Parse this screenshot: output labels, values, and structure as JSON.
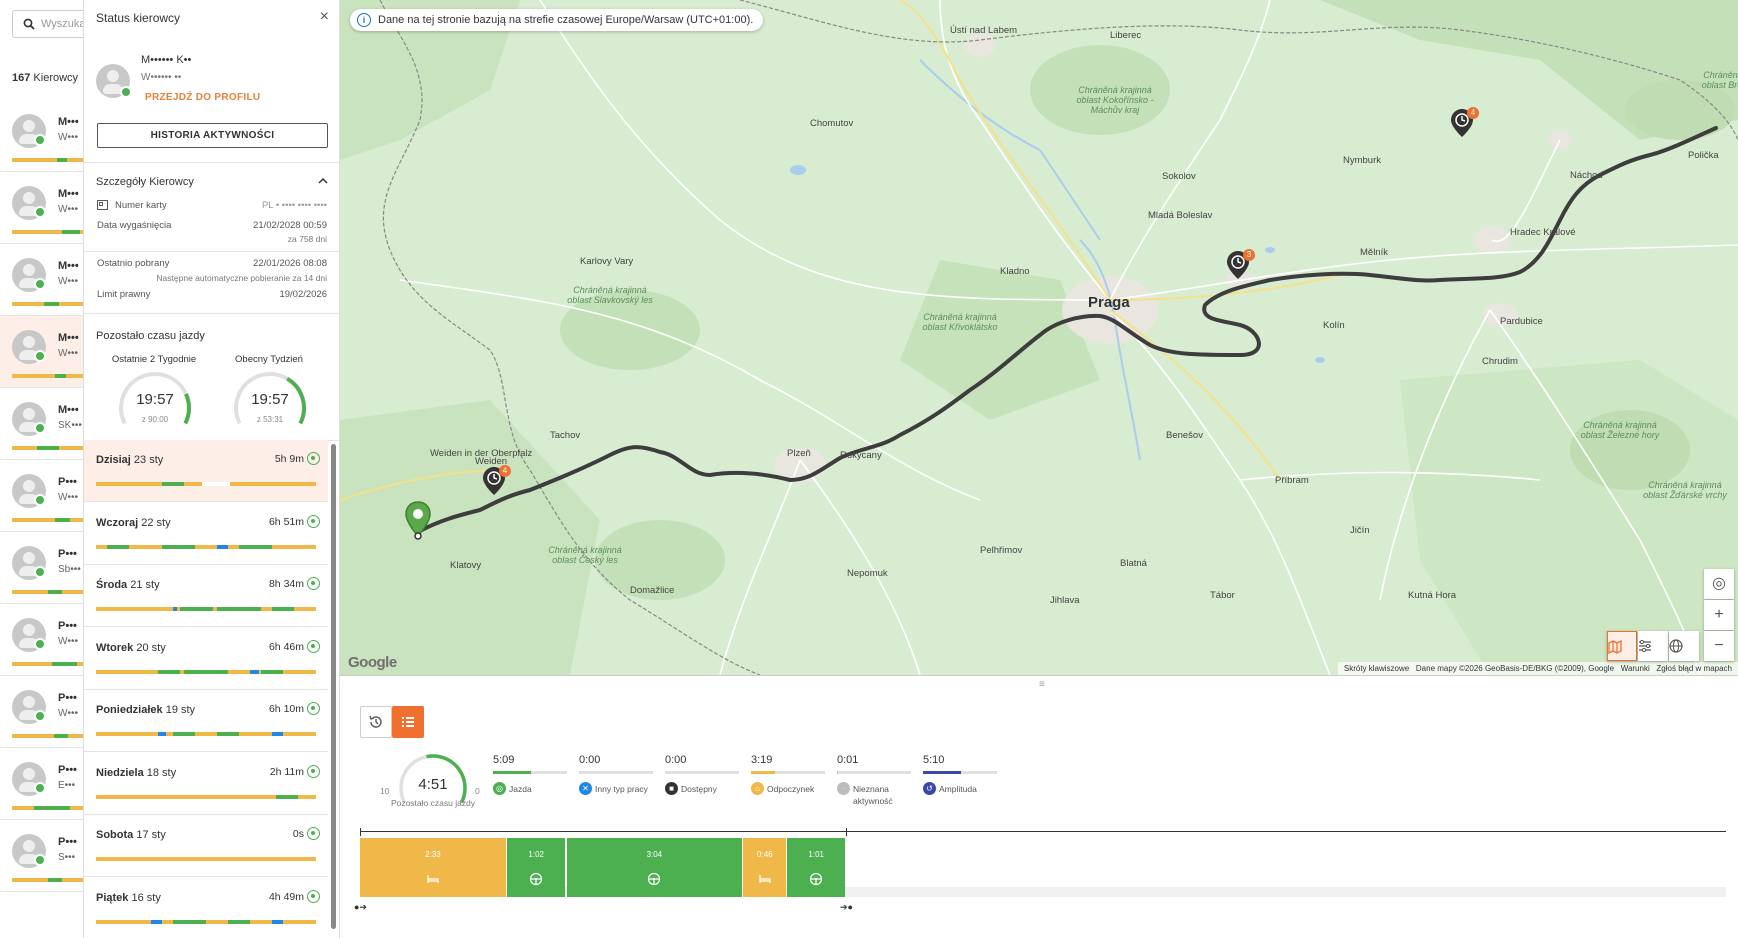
{
  "driver_list": {
    "search_placeholder": "Wyszukaj",
    "count": "167",
    "count_label": "Kierowcy",
    "rows": [
      {
        "name": "M•••",
        "sub": "W•••"
      },
      {
        "name": "M•••",
        "sub": "W•••"
      },
      {
        "name": "M•••",
        "sub": "W•••"
      },
      {
        "name": "M•••",
        "sub": "W•••"
      },
      {
        "name": "M•••",
        "sub": "SK•••"
      },
      {
        "name": "P•••",
        "sub": "W•••"
      },
      {
        "name": "P•••",
        "sub": "Sb•••"
      },
      {
        "name": "P•••",
        "sub": "W•••"
      },
      {
        "name": "P•••",
        "sub": "W•••"
      },
      {
        "name": "P•••",
        "sub": "E•••"
      },
      {
        "name": "P•••",
        "sub": "S•••"
      }
    ]
  },
  "status_panel": {
    "title": "Status kierowcy",
    "close": "×",
    "driver_name": "M••••••  K••",
    "driver_id": "W••••••  ••",
    "profile_link": "PRZEJDŹ DO PROFILU",
    "history_button": "HISTORIA AKTYWNOŚCI",
    "details_title": "Szczegóły Kierowcy",
    "card_label": "Numer karty",
    "card_value": "PL  •  ••••  ••••  ••••",
    "expiry_label": "Data wygaśnięcia",
    "expiry_value": "21/02/2028 00:59",
    "expiry_sub": "za 758 dni",
    "downloaded_label": "Ostatnio pobrany",
    "downloaded_value": "22/01/2026 08:08",
    "next_download": "Następne automatyczne pobieranie za 14 dni",
    "legal_limit_label": "Limit prawny",
    "legal_limit_value": "19/02/2026",
    "remaining_title": "Pozostało czasu jazdy",
    "gauges": [
      {
        "label": "Ostatnie 2 Tygodnie",
        "value": "19:57",
        "sub": "z 90:00",
        "fraction": 0.22
      },
      {
        "label": "Obecny Tydzień",
        "value": "19:57",
        "sub": "z 53:31",
        "fraction": 0.37
      }
    ],
    "days": [
      {
        "day": "Dzisiaj",
        "date": "23 sty",
        "duration": "5h 9m"
      },
      {
        "day": "Wczoraj",
        "date": "22 sty",
        "duration": "6h 51m"
      },
      {
        "day": "Środa",
        "date": "21 sty",
        "duration": "8h 34m"
      },
      {
        "day": "Wtorek",
        "date": "20 sty",
        "duration": "6h 46m"
      },
      {
        "day": "Poniedziałek",
        "date": "19 sty",
        "duration": "6h 10m"
      },
      {
        "day": "Niedziela",
        "date": "18 sty",
        "duration": "2h 11m"
      },
      {
        "day": "Sobota",
        "date": "17 sty",
        "duration": "0s"
      },
      {
        "day": "Piątek",
        "date": "16 sty",
        "duration": "4h 49m"
      }
    ]
  },
  "map": {
    "timezone_banner": "Dane na tej stronie bazują na strefie czasowej Europe/Warsaw (UTC+01:00).",
    "brand": "Google",
    "attribution": [
      "Skróty klawiszowe",
      "Dane mapy ©2026 GeoBasis-DE/BKG (©2009), Google",
      "Warunki",
      "Zgłoś błąd w mapach"
    ],
    "capital": "Praga",
    "places": [
      {
        "name": "Ústí nad Labem",
        "type": "town"
      },
      {
        "name": "Liberec",
        "type": "town"
      },
      {
        "name": "Hradec Králové",
        "type": "town"
      },
      {
        "name": "Pardubice",
        "type": "town"
      },
      {
        "name": "Plzeň",
        "type": "town"
      },
      {
        "name": "Kolín",
        "type": "town"
      },
      {
        "name": "Příbram",
        "type": "town"
      },
      {
        "name": "Chomutov",
        "type": "town"
      },
      {
        "name": "Kladno",
        "type": "town"
      },
      {
        "name": "Mladá Boleslav",
        "type": "town"
      },
      {
        "name": "Náchod",
        "type": "town"
      },
      {
        "name": "Weiden in der Oberpfalz",
        "type": "town"
      },
      {
        "name": "Weiden",
        "type": "town"
      },
      {
        "name": "Polička",
        "type": "town"
      },
      {
        "name": "Chrudim",
        "type": "town"
      },
      {
        "name": "Benešov",
        "type": "town"
      },
      {
        "name": "Rokycany",
        "type": "town"
      },
      {
        "name": "Klatovy",
        "type": "town"
      },
      {
        "name": "Domažlice",
        "type": "town"
      },
      {
        "name": "Tábor",
        "type": "town"
      },
      {
        "name": "Jihlava",
        "type": "town"
      },
      {
        "name": "Pelhřimov",
        "type": "town"
      },
      {
        "name": "Kutná Hora",
        "type": "town"
      },
      {
        "name": "Jičín",
        "type": "town"
      },
      {
        "name": "Nymburk",
        "type": "town"
      },
      {
        "name": "Mělník",
        "type": "town"
      },
      {
        "name": "Sokolov",
        "type": "town"
      },
      {
        "name": "Karlovy Vary",
        "type": "town"
      },
      {
        "name": "Tachov",
        "type": "town"
      },
      {
        "name": "Nepomuk",
        "type": "town"
      },
      {
        "name": "Blatná",
        "type": "town"
      }
    ],
    "parks": [
      "Chráněná krajinná oblast Slavkovský les",
      "Chráněná krajinná oblast Křivoklátsko",
      "Chráněná krajinná oblast Český les",
      "Chráněná krajinná oblast Kokořínsko - Máchův kraj",
      "Chráněná krajinná oblast Broumovsko",
      "Chráněná krajinná oblast Železné hory",
      "Chráněná krajinná oblast Žďárské vrchy"
    ],
    "markers": [
      {
        "type": "start",
        "badge": ""
      },
      {
        "type": "rest",
        "badge": "4"
      },
      {
        "type": "rest",
        "badge": "3"
      },
      {
        "type": "rest",
        "badge": "4"
      }
    ],
    "controls": {
      "locate": "◎",
      "zoom_in": "+",
      "zoom_out": "−"
    }
  },
  "activity": {
    "remaining_value": "4:51",
    "remaining_label": "Pozostało czasu jazdy",
    "gauge_min": "10",
    "gauge_max": "0",
    "gauge_fraction": 0.55,
    "stats": [
      {
        "value": "5:09",
        "label": "Jazda",
        "color": "#4caf50",
        "fraction": 0.52
      },
      {
        "value": "0:00",
        "label": "Inny typ pracy",
        "color": "#1e88e5",
        "fraction": 0
      },
      {
        "value": "0:00",
        "label": "Dostępny",
        "color": "#333333",
        "fraction": 0
      },
      {
        "value": "3:19",
        "label": "Odpoczynek",
        "color": "#f0b849",
        "fraction": 0.33
      },
      {
        "value": "0:01",
        "label": "Nieznana aktywność",
        "color": "#bdbdbd",
        "fraction": 0.01
      },
      {
        "value": "5:10",
        "label": "Amplituda",
        "color": "#3949ab",
        "fraction": 0.52
      }
    ],
    "segments": [
      {
        "label": "2:33",
        "type": "rest",
        "color": "#f0b849",
        "minutes": 153
      },
      {
        "label": "1:02",
        "type": "drive",
        "color": "#4caf50",
        "minutes": 62
      },
      {
        "label": "3:04",
        "type": "drive",
        "color": "#4caf50",
        "minutes": 184
      },
      {
        "label": "0:46",
        "type": "rest",
        "color": "#f0b849",
        "minutes": 46
      },
      {
        "label": "1:01",
        "type": "drive",
        "color": "#4caf50",
        "minutes": 61
      }
    ]
  }
}
